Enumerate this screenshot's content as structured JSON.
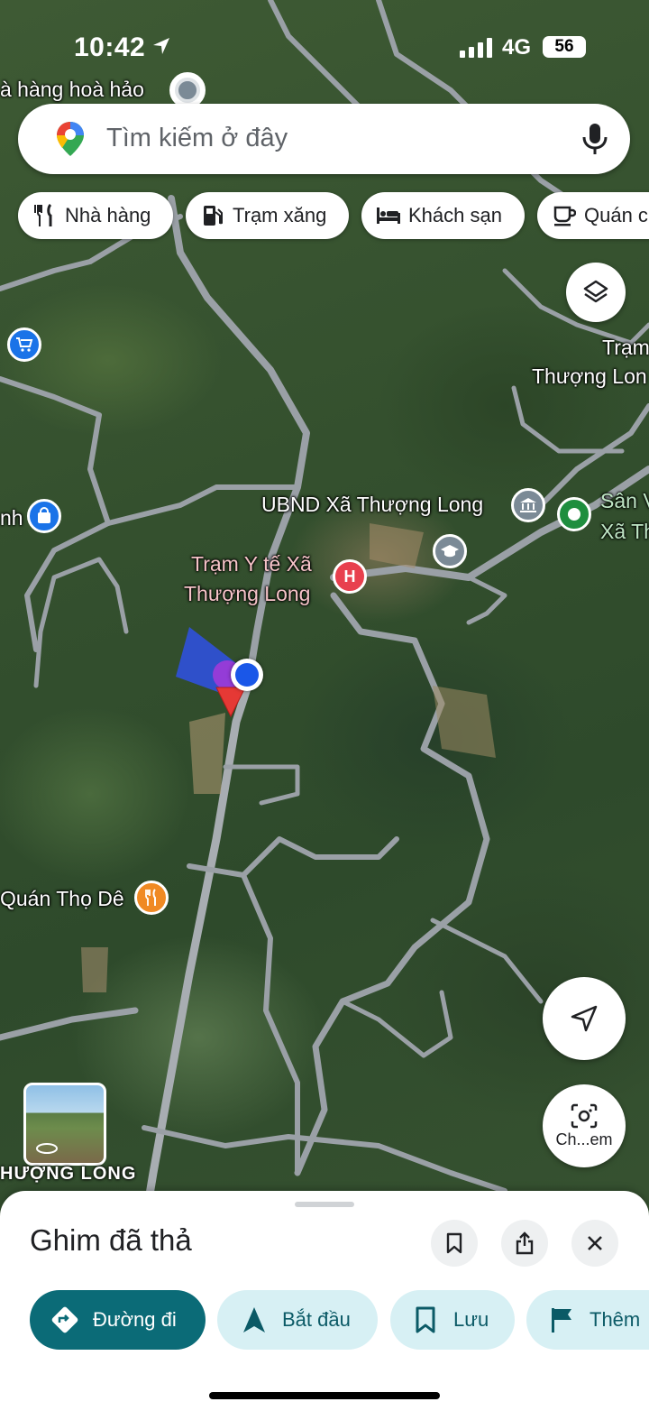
{
  "status_bar": {
    "time": "10:42",
    "network": "4G",
    "battery": "56",
    "icons": [
      "location-arrow-icon",
      "signal-bars-icon"
    ]
  },
  "search": {
    "placeholder": "Tìm kiếm ở đây",
    "logo_icon": "google-maps-pin-icon",
    "mic_icon": "microphone-icon"
  },
  "chips": [
    {
      "label": "Nhà hàng",
      "icon": "fork-knife-icon"
    },
    {
      "label": "Trạm xăng",
      "icon": "gas-station-icon"
    },
    {
      "label": "Khách sạn",
      "icon": "bed-icon"
    },
    {
      "label": "Quán c",
      "icon": "coffee-cup-icon"
    }
  ],
  "map": {
    "labels": {
      "top_restaurant": "à hàng hoà hảo",
      "tram_top_1": "Trạm",
      "tram_top_2": "Thượng Lon",
      "ubnd": "UBND Xã Thượng Long",
      "san_1": "Sân V",
      "san_2": "Xã Th",
      "left_shop": "nh",
      "clinic_1": "Trạm Y tế Xã",
      "clinic_2": "Thượng Long",
      "quan": "Quán Thọ Dê",
      "clinic_marker": "H"
    },
    "colors": {
      "clinic_marker": "#e8404e",
      "restaurant_marker": "#f08a24",
      "shop_marker": "#1a73e8",
      "park_marker": "#1e8e3e",
      "gov_marker": "#7b8a96",
      "my_location": "#1a57e8",
      "dropped_pin": "#e53935"
    }
  },
  "street_view": {
    "label": "HƯỢNG LONG"
  },
  "buttons": {
    "layers_icon": "layers-icon",
    "recenter_icon": "navigation-arrow-icon",
    "lens_label": "Ch...em",
    "lens_icon": "camera-search-icon"
  },
  "sheet": {
    "title": "Ghim đã thả",
    "header_icons": [
      "bookmark-icon",
      "share-icon",
      "close-icon"
    ],
    "actions": [
      {
        "label": "Đường đi",
        "icon": "directions-icon"
      },
      {
        "label": "Bắt đầu",
        "icon": "navigation-icon"
      },
      {
        "label": "Lưu",
        "icon": "bookmark-icon"
      },
      {
        "label": "Thêm",
        "icon": "flag-icon"
      }
    ]
  }
}
